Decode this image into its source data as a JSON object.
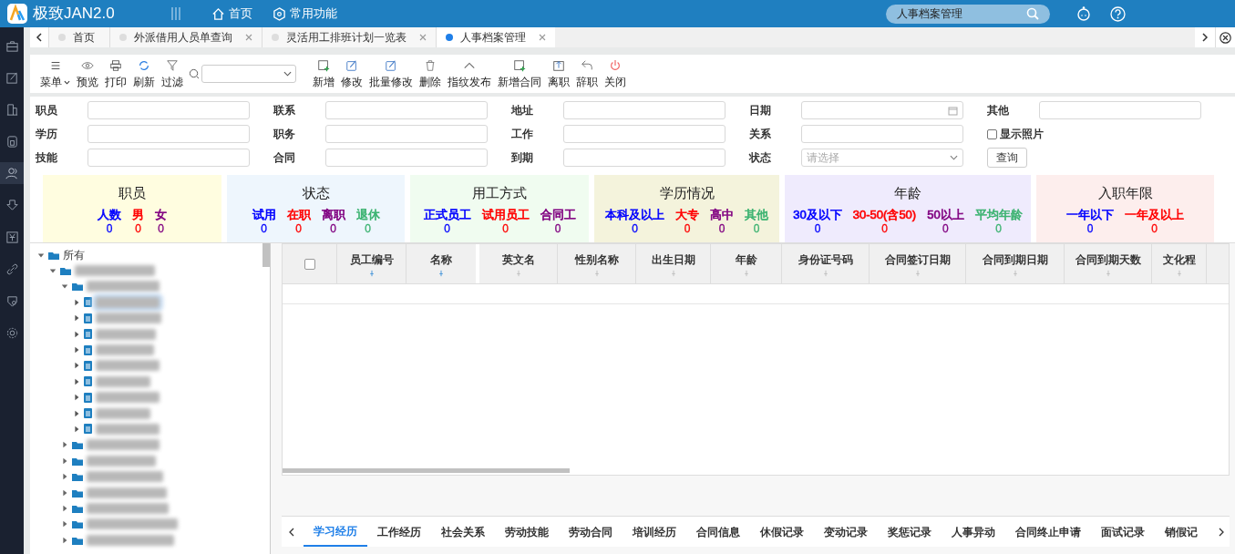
{
  "app": {
    "title": "极致JAN2.0",
    "nav": [
      "首页",
      "常用功能"
    ],
    "search_value": "人事档案管理"
  },
  "tabs": [
    {
      "label": "首页",
      "selected": false,
      "closable": false
    },
    {
      "label": "外派借用人员单查询",
      "selected": false,
      "closable": true
    },
    {
      "label": "灵活用工排班计划一览表",
      "selected": false,
      "closable": true
    },
    {
      "label": "人事档案管理",
      "selected": true,
      "closable": true
    }
  ],
  "toolbar": [
    {
      "kind": "button",
      "label": "菜单"
    },
    {
      "kind": "button",
      "label": "预览"
    },
    {
      "kind": "button",
      "label": "打印"
    },
    {
      "kind": "button",
      "label": "刷新"
    },
    {
      "kind": "button",
      "label": "过滤"
    },
    {
      "kind": "search"
    },
    {
      "kind": "button",
      "label": "新增"
    },
    {
      "kind": "button",
      "label": "修改"
    },
    {
      "kind": "button",
      "label": "批量修改"
    },
    {
      "kind": "button",
      "label": "删除"
    },
    {
      "kind": "button",
      "label": "指纹发布"
    },
    {
      "kind": "button",
      "label": "新增合同"
    },
    {
      "kind": "button",
      "label": "离职"
    },
    {
      "kind": "button",
      "label": "辞职"
    },
    {
      "kind": "button",
      "label": "关闭"
    }
  ],
  "form": [
    [
      {
        "label": "职员"
      },
      {
        "label": "联系"
      },
      {
        "label": "地址"
      },
      {
        "label": "日期",
        "kind": "date"
      },
      {
        "label": "其他"
      }
    ],
    [
      {
        "label": "学历"
      },
      {
        "label": "职务"
      },
      {
        "label": "工作"
      },
      {
        "label": "关系"
      },
      {
        "label": "显示照片",
        "kind": "checkbox",
        "checked": false
      }
    ],
    [
      {
        "label": "技能"
      },
      {
        "label": "合同"
      },
      {
        "label": "到期"
      },
      {
        "label": "状态",
        "kind": "select",
        "placeholder": "请选择"
      },
      {
        "label": "查询",
        "kind": "button"
      }
    ]
  ],
  "stats": [
    {
      "title": "职员",
      "color": "#fffde0",
      "items": [
        {
          "label": "人数",
          "value": "0",
          "color": "#0000ff"
        },
        {
          "label": "男",
          "value": "0",
          "color": "#ff0000"
        },
        {
          "label": "女",
          "value": "0",
          "color": "#800080"
        }
      ]
    },
    {
      "title": "状态",
      "color": "#eef6fd",
      "items": [
        {
          "label": "试用",
          "value": "0",
          "color": "#0000ff"
        },
        {
          "label": "在职",
          "value": "0",
          "color": "#ff0000"
        },
        {
          "label": "离职",
          "value": "0",
          "color": "#800080"
        },
        {
          "label": "退休",
          "value": "0",
          "color": "#3cb371"
        }
      ]
    },
    {
      "title": "用工方式",
      "color": "#f0fcf0",
      "items": [
        {
          "label": "正式员工",
          "value": "0",
          "color": "#0000ff"
        },
        {
          "label": "试用员工",
          "value": "0",
          "color": "#ff0000"
        },
        {
          "label": "合同工",
          "value": "0",
          "color": "#800080"
        }
      ]
    },
    {
      "title": "学历情况",
      "color": "#f4f3dc",
      "items": [
        {
          "label": "本科及以上",
          "value": "0",
          "color": "#0000ff"
        },
        {
          "label": "大专",
          "value": "0",
          "color": "#ff0000"
        },
        {
          "label": "高中",
          "value": "0",
          "color": "#800080"
        },
        {
          "label": "其他",
          "value": "0",
          "color": "#3cb371"
        }
      ]
    },
    {
      "title": "年龄",
      "color": "#efebfd",
      "items": [
        {
          "label": "30及以下",
          "value": "0",
          "color": "#0000ff"
        },
        {
          "label": "30-50(含50)",
          "value": "0",
          "color": "#ff0000"
        },
        {
          "label": "50以上",
          "value": "0",
          "color": "#800080"
        },
        {
          "label": "平均年龄",
          "value": "0",
          "color": "#3cb371"
        }
      ]
    },
    {
      "title": "入职年限",
      "color": "#fdeeed",
      "items": [
        {
          "label": "一年以下",
          "value": "0",
          "color": "#0000ff"
        },
        {
          "label": "一年及以上",
          "value": "0",
          "color": "#ff0000"
        }
      ]
    }
  ],
  "tree": [
    {
      "label": "所有",
      "kind": "folder",
      "expanded": true,
      "children": [
        {
          "kind": "folder",
          "expanded": true,
          "children": [
            {
              "kind": "folder",
              "expanded": true,
              "children": [
                {
                  "kind": "doc",
                  "selected": true
                },
                {
                  "kind": "doc",
                  "selected": false
                },
                {
                  "kind": "doc",
                  "selected": false
                },
                {
                  "kind": "doc",
                  "selected": false
                },
                {
                  "kind": "doc",
                  "selected": false
                },
                {
                  "kind": "doc",
                  "selected": false
                },
                {
                  "kind": "doc",
                  "selected": false
                },
                {
                  "kind": "doc",
                  "selected": false
                },
                {
                  "kind": "doc",
                  "selected": false
                }
              ]
            },
            {
              "kind": "folder",
              "expanded": false
            },
            {
              "kind": "folder",
              "expanded": false
            },
            {
              "kind": "folder",
              "expanded": false
            },
            {
              "kind": "folder",
              "expanded": false
            },
            {
              "kind": "folder",
              "expanded": false
            },
            {
              "kind": "folder",
              "expanded": false
            },
            {
              "kind": "folder",
              "expanded": false
            }
          ]
        }
      ]
    }
  ],
  "table": {
    "select_all": {
      "checked": false
    },
    "columns": [
      {
        "label": "员工编号",
        "pinned": true
      },
      {
        "label": "名称",
        "pinned": true
      },
      {
        "label": "英文名",
        "pinned": false
      },
      {
        "label": "性别名称",
        "pinned": false
      },
      {
        "label": "出生日期",
        "pinned": false
      },
      {
        "label": "年龄",
        "pinned": false
      },
      {
        "label": "身份证号码",
        "pinned": false
      },
      {
        "label": "合同签订日期",
        "pinned": false
      },
      {
        "label": "合同到期日期",
        "pinned": false
      },
      {
        "label": "合同到期天数",
        "pinned": false
      },
      {
        "label": "文化程",
        "pinned": false
      }
    ]
  },
  "bottom_tabs": [
    {
      "label": "学习经历",
      "selected": true
    },
    {
      "label": "工作经历",
      "selected": false
    },
    {
      "label": "社会关系",
      "selected": false
    },
    {
      "label": "劳动技能",
      "selected": false
    },
    {
      "label": "劳动合同",
      "selected": false
    },
    {
      "label": "培训经历",
      "selected": false
    },
    {
      "label": "合同信息",
      "selected": false
    },
    {
      "label": "休假记录",
      "selected": false
    },
    {
      "label": "变动记录",
      "selected": false
    },
    {
      "label": "奖惩记录",
      "selected": false
    },
    {
      "label": "人事异动",
      "selected": false
    },
    {
      "label": "合同终止申请",
      "selected": false
    },
    {
      "label": "面试记录",
      "selected": false
    },
    {
      "label": "销假记",
      "selected": false
    }
  ]
}
